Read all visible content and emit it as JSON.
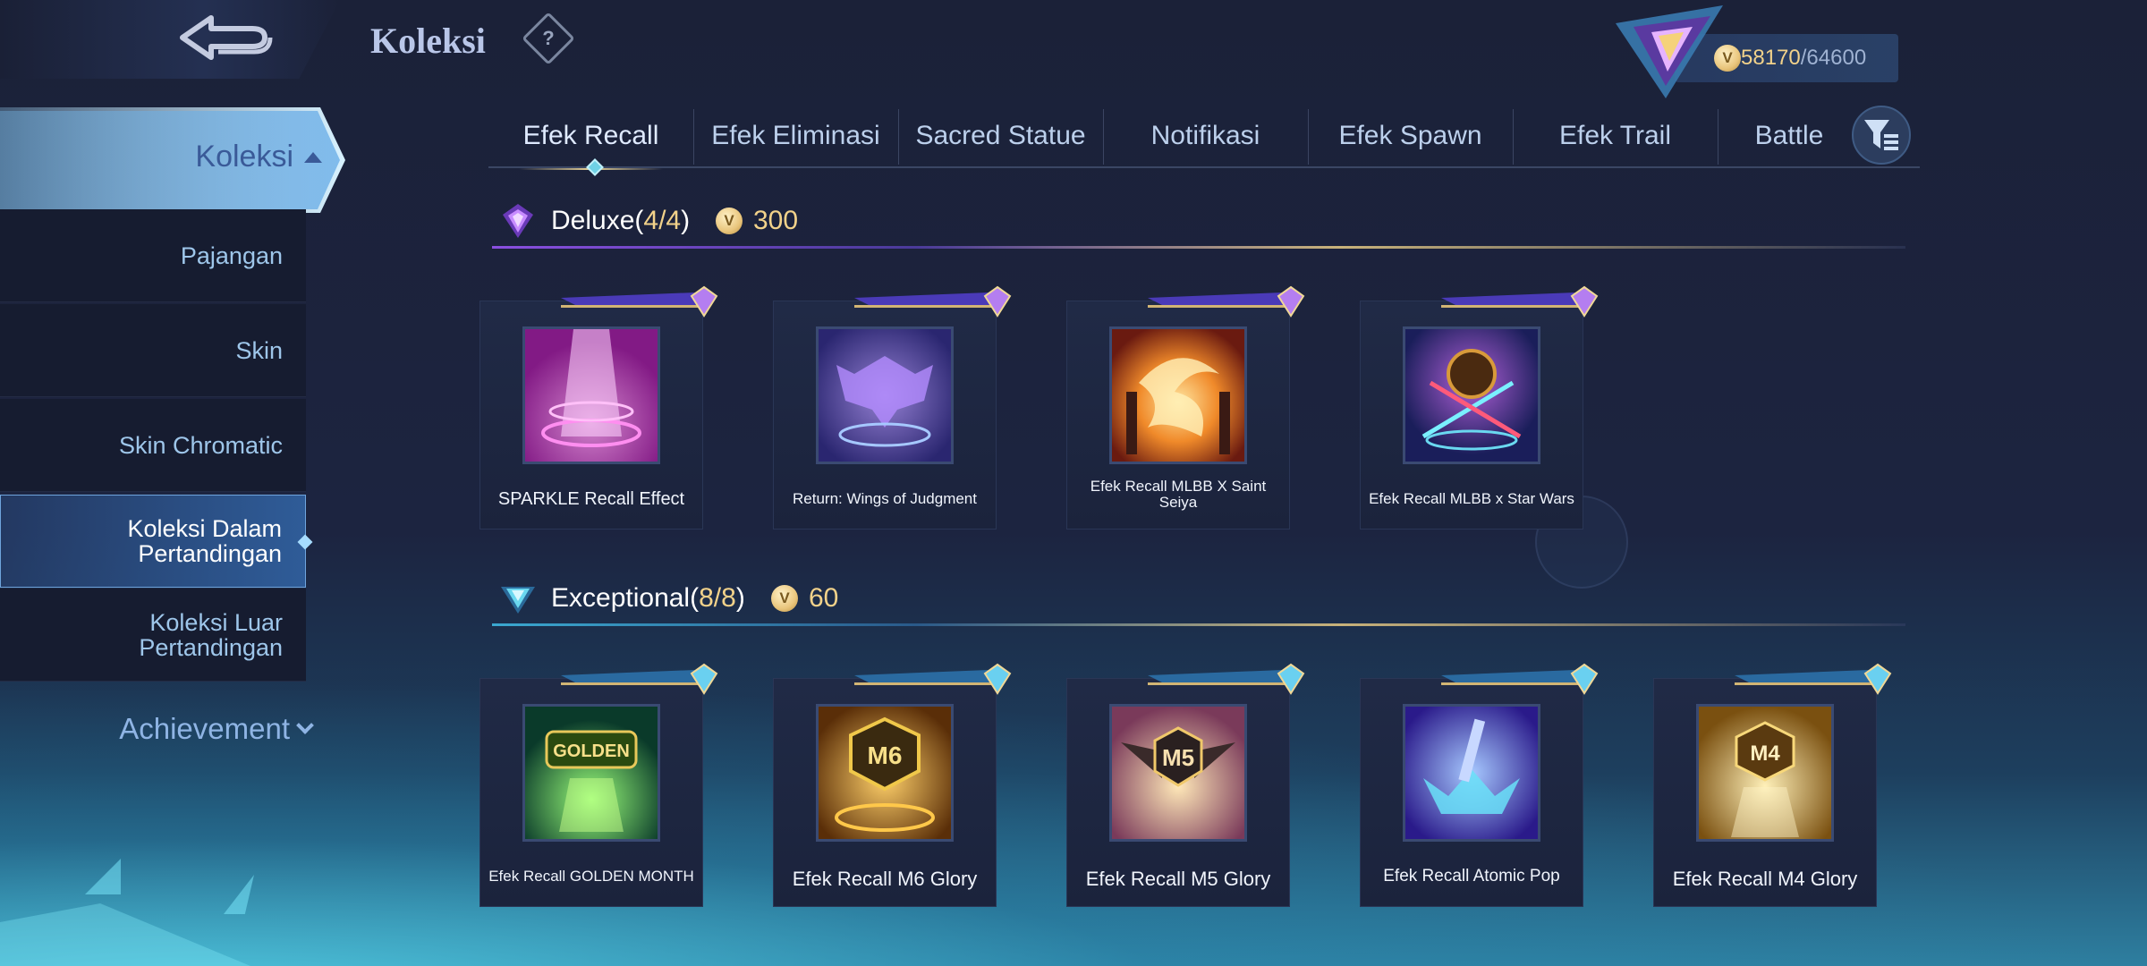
{
  "header": {
    "title": "Koleksi",
    "help_icon": "question-icon",
    "back_icon": "back-arrow-icon"
  },
  "currency": {
    "icon": "battle-point-coin-icon",
    "current": "58170",
    "separator": "/",
    "max": "64600"
  },
  "sidebar": {
    "section": {
      "label": "Koleksi",
      "icon": "caret-up-icon"
    },
    "items": [
      {
        "label": "Pajangan"
      },
      {
        "label": "Skin"
      },
      {
        "label": "Skin Chromatic"
      },
      {
        "label": "Koleksi Dalam Pertandingan",
        "active": true
      },
      {
        "label": "Koleksi Luar Pertandingan"
      }
    ],
    "achievement": {
      "label": "Achievement",
      "icon": "caret-down-icon"
    }
  },
  "tabs": [
    {
      "label": "Efek Recall",
      "active": true
    },
    {
      "label": "Efek Eliminasi"
    },
    {
      "label": "Sacred Statue"
    },
    {
      "label": "Notifikasi"
    },
    {
      "label": "Efek Spawn"
    },
    {
      "label": "Efek Trail"
    },
    {
      "label": "Battle"
    }
  ],
  "filter_icon": "filter-list-icon",
  "sections": [
    {
      "name": "Deluxe",
      "owned": "4",
      "total": "4",
      "points": "300",
      "color": "#9b5cf0",
      "items": [
        {
          "name": "SPARKLE Recall Effect",
          "art": "pink-light-beam"
        },
        {
          "name": "Return: Wings of Judgment",
          "art": "purple-wings"
        },
        {
          "name": "Efek Recall MLBB X Saint Seiya",
          "art": "golden-flame"
        },
        {
          "name": "Efek Recall MLBB x Star Wars",
          "art": "crossed-lightsabers"
        }
      ]
    },
    {
      "name": "Exceptional",
      "owned": "8",
      "total": "8",
      "points": "60",
      "color": "#4fb8d8",
      "items": [
        {
          "name": "Efek Recall GOLDEN MONTH",
          "art": "golden-month-green"
        },
        {
          "name": "Efek Recall M6 Glory",
          "art": "m6-gold"
        },
        {
          "name": "Efek Recall M5 Glory",
          "art": "m5-wings"
        },
        {
          "name": "Efek Recall Atomic Pop",
          "art": "blue-crown"
        },
        {
          "name": "Efek Recall M4 Glory",
          "art": "m4-gold"
        }
      ]
    }
  ]
}
